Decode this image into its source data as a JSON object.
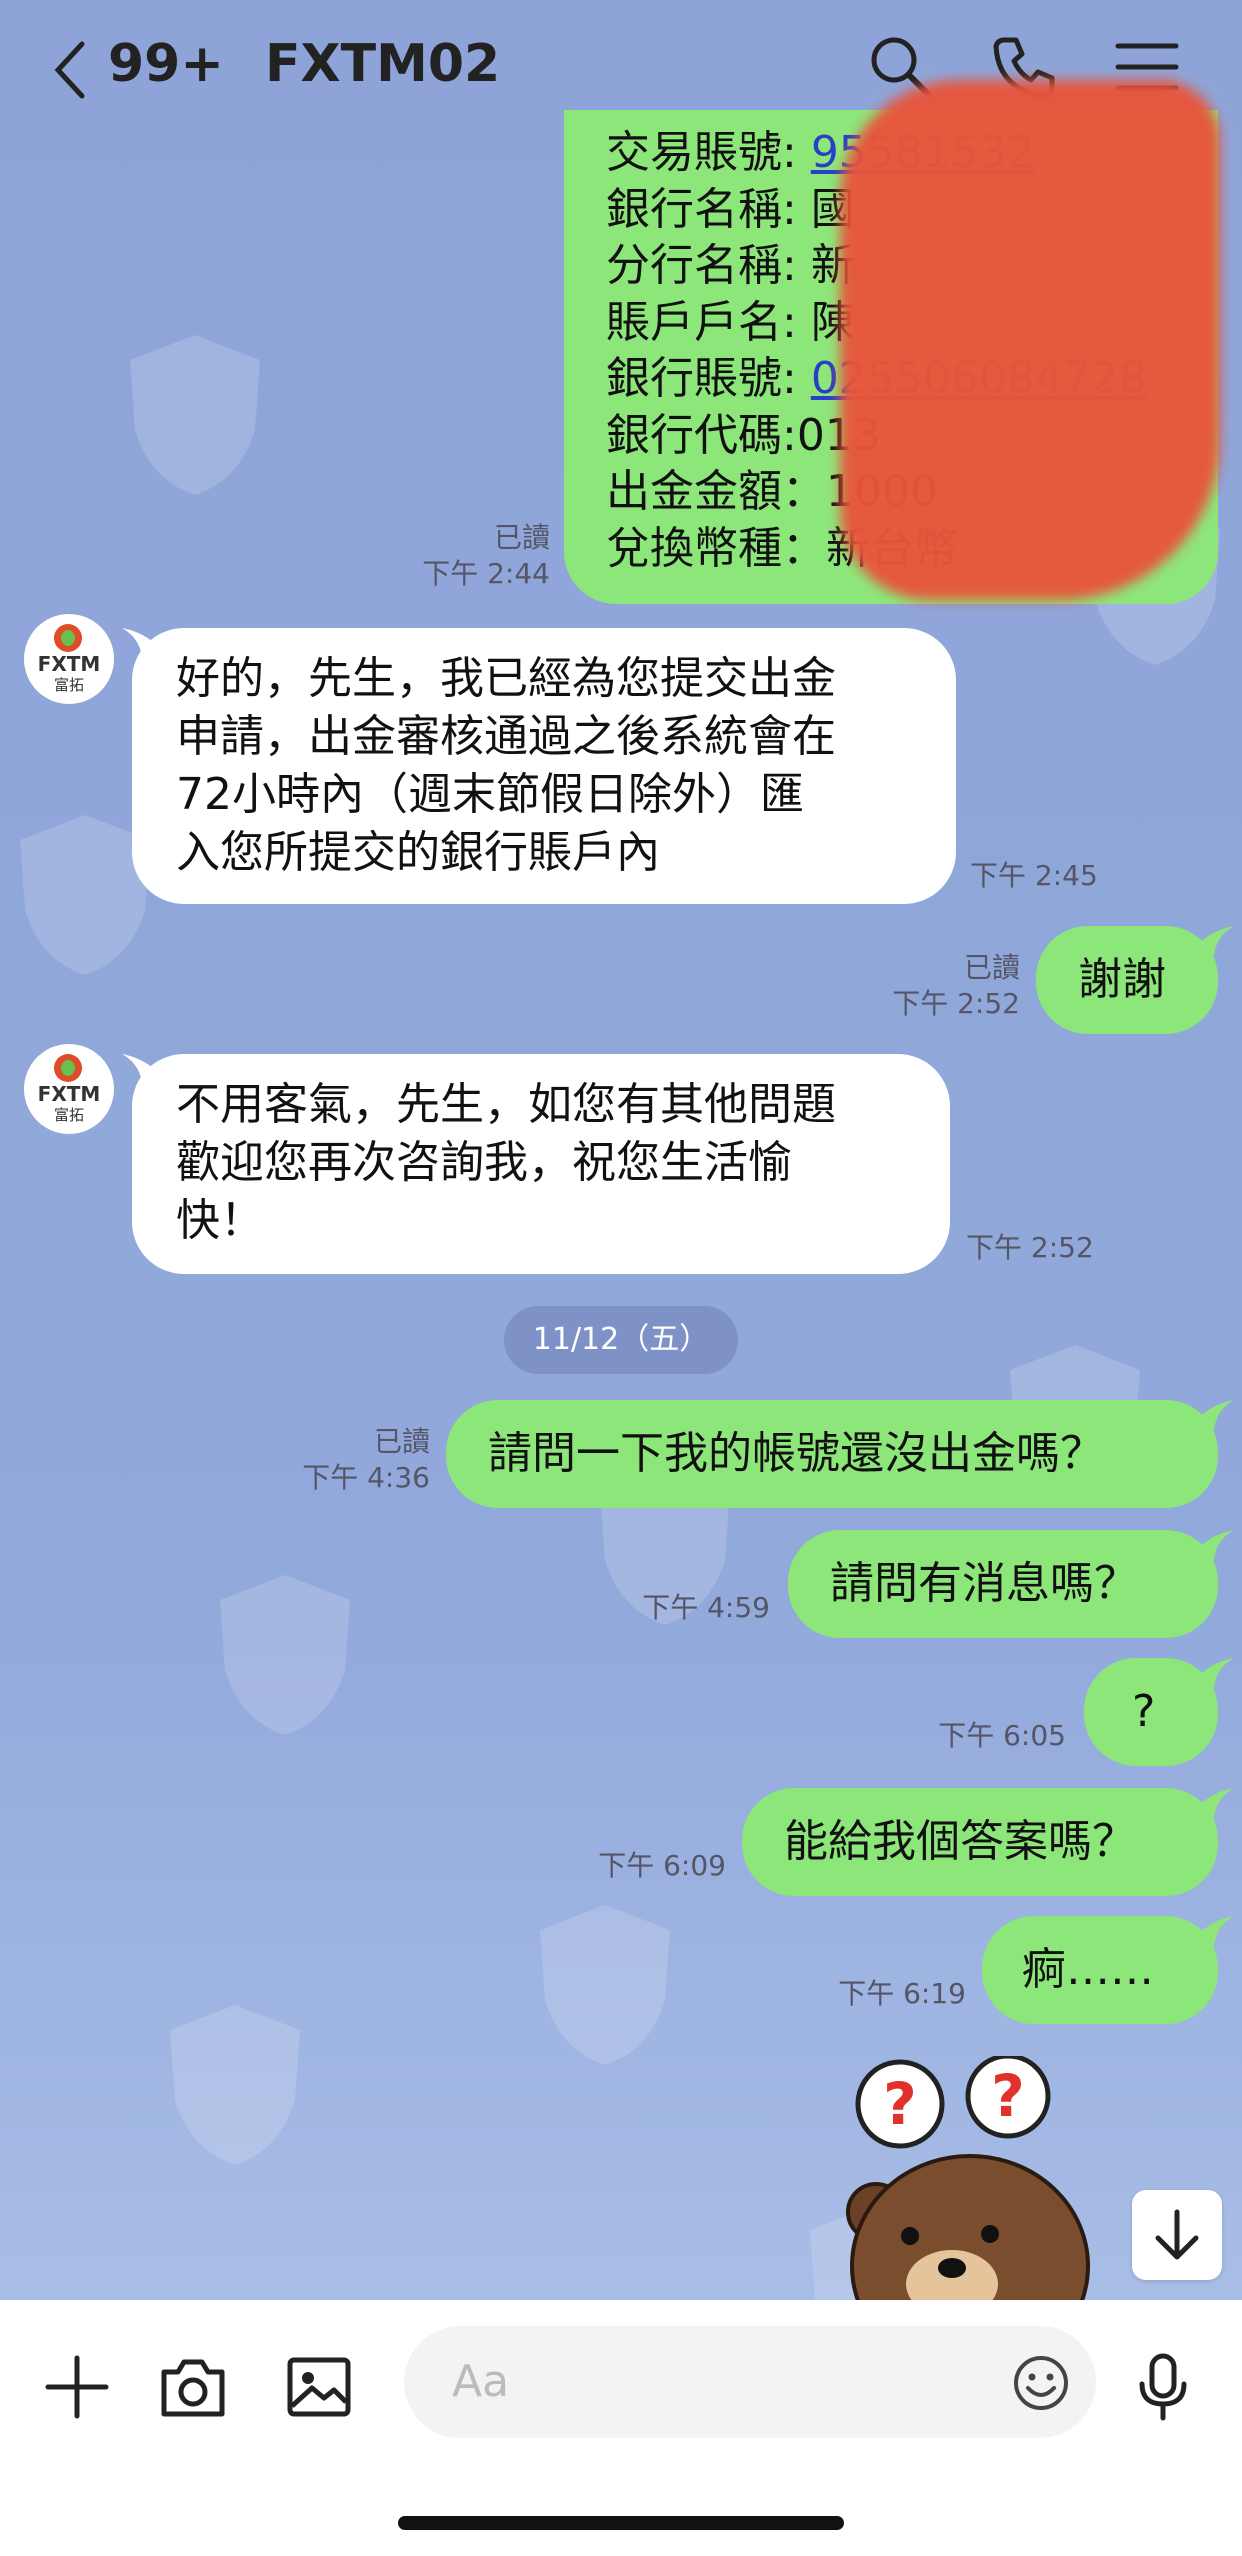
{
  "header": {
    "back_icon": "chevron-left-icon",
    "unread_count": "99+",
    "title": "FXTM02",
    "icons": [
      "search-icon",
      "phone-icon",
      "menu-icon"
    ]
  },
  "transfer_details": {
    "lines": [
      {
        "label": "交易賬號: ",
        "value": "95581532"
      },
      {
        "label": "銀行名稱: ",
        "value": "國"
      },
      {
        "label": "分行名稱: ",
        "value": "新"
      },
      {
        "label": "賬戶戶名: ",
        "value": "陳"
      },
      {
        "label": "銀行賬號: ",
        "value": "025506084728"
      },
      {
        "label": "銀行代碼:",
        "value": "013"
      },
      {
        "label": "出金金額：",
        "value": "1000"
      },
      {
        "label": "兌換幣種：",
        "value": "新台幣"
      }
    ],
    "read": "已讀",
    "time": "下午 2:44"
  },
  "messages": [
    {
      "dir": "in",
      "avatar_text": "FXTM",
      "avatar_sub": "富拓",
      "lines": [
        "好的，先生，我已經為您提交出金",
        "申請，出金審核通過之後系統會在",
        "72小時內（週末節假日除外）匯",
        "入您所提交的銀行賬戶內"
      ],
      "time": "下午 2:45"
    },
    {
      "dir": "out",
      "text": "謝謝",
      "read": "已讀",
      "time": "下午 2:52"
    },
    {
      "dir": "in",
      "avatar_text": "FXTM",
      "avatar_sub": "富拓",
      "lines": [
        "不用客氣，先生，如您有其他問題",
        "歡迎您再次咨詢我，祝您生活愉",
        "快！"
      ],
      "time": "下午 2:52"
    },
    {
      "dir": "out",
      "text": "請問一下我的帳號還沒出金嗎？",
      "read": "已讀",
      "time": "下午 4:36"
    },
    {
      "dir": "out",
      "text": "請問有消息嗎？",
      "time": "下午 4:59"
    },
    {
      "dir": "out",
      "text": "?",
      "time": "下午 6:05"
    },
    {
      "dir": "out",
      "text": "能給我個答案嗎？",
      "time": "下午 6:09"
    },
    {
      "dir": "out",
      "text": "痾……",
      "time": "下午 6:19"
    }
  ],
  "date_separator": "11/12（五）",
  "sticker": {
    "icon": "bear-confused-sticker",
    "marks": [
      "?",
      "?"
    ]
  },
  "composer": {
    "placeholder": "Aa",
    "icons": [
      "plus-icon",
      "camera-icon",
      "image-icon",
      "emoji-icon",
      "microphone-icon"
    ],
    "scroll_icon": "arrow-down-icon"
  },
  "colors": {
    "chat_bg": "#8fa5d6",
    "out_bubble": "#8de67a",
    "in_bubble": "#ffffff",
    "date_pill": "#7f92c7",
    "link": "#2a3fc8"
  }
}
